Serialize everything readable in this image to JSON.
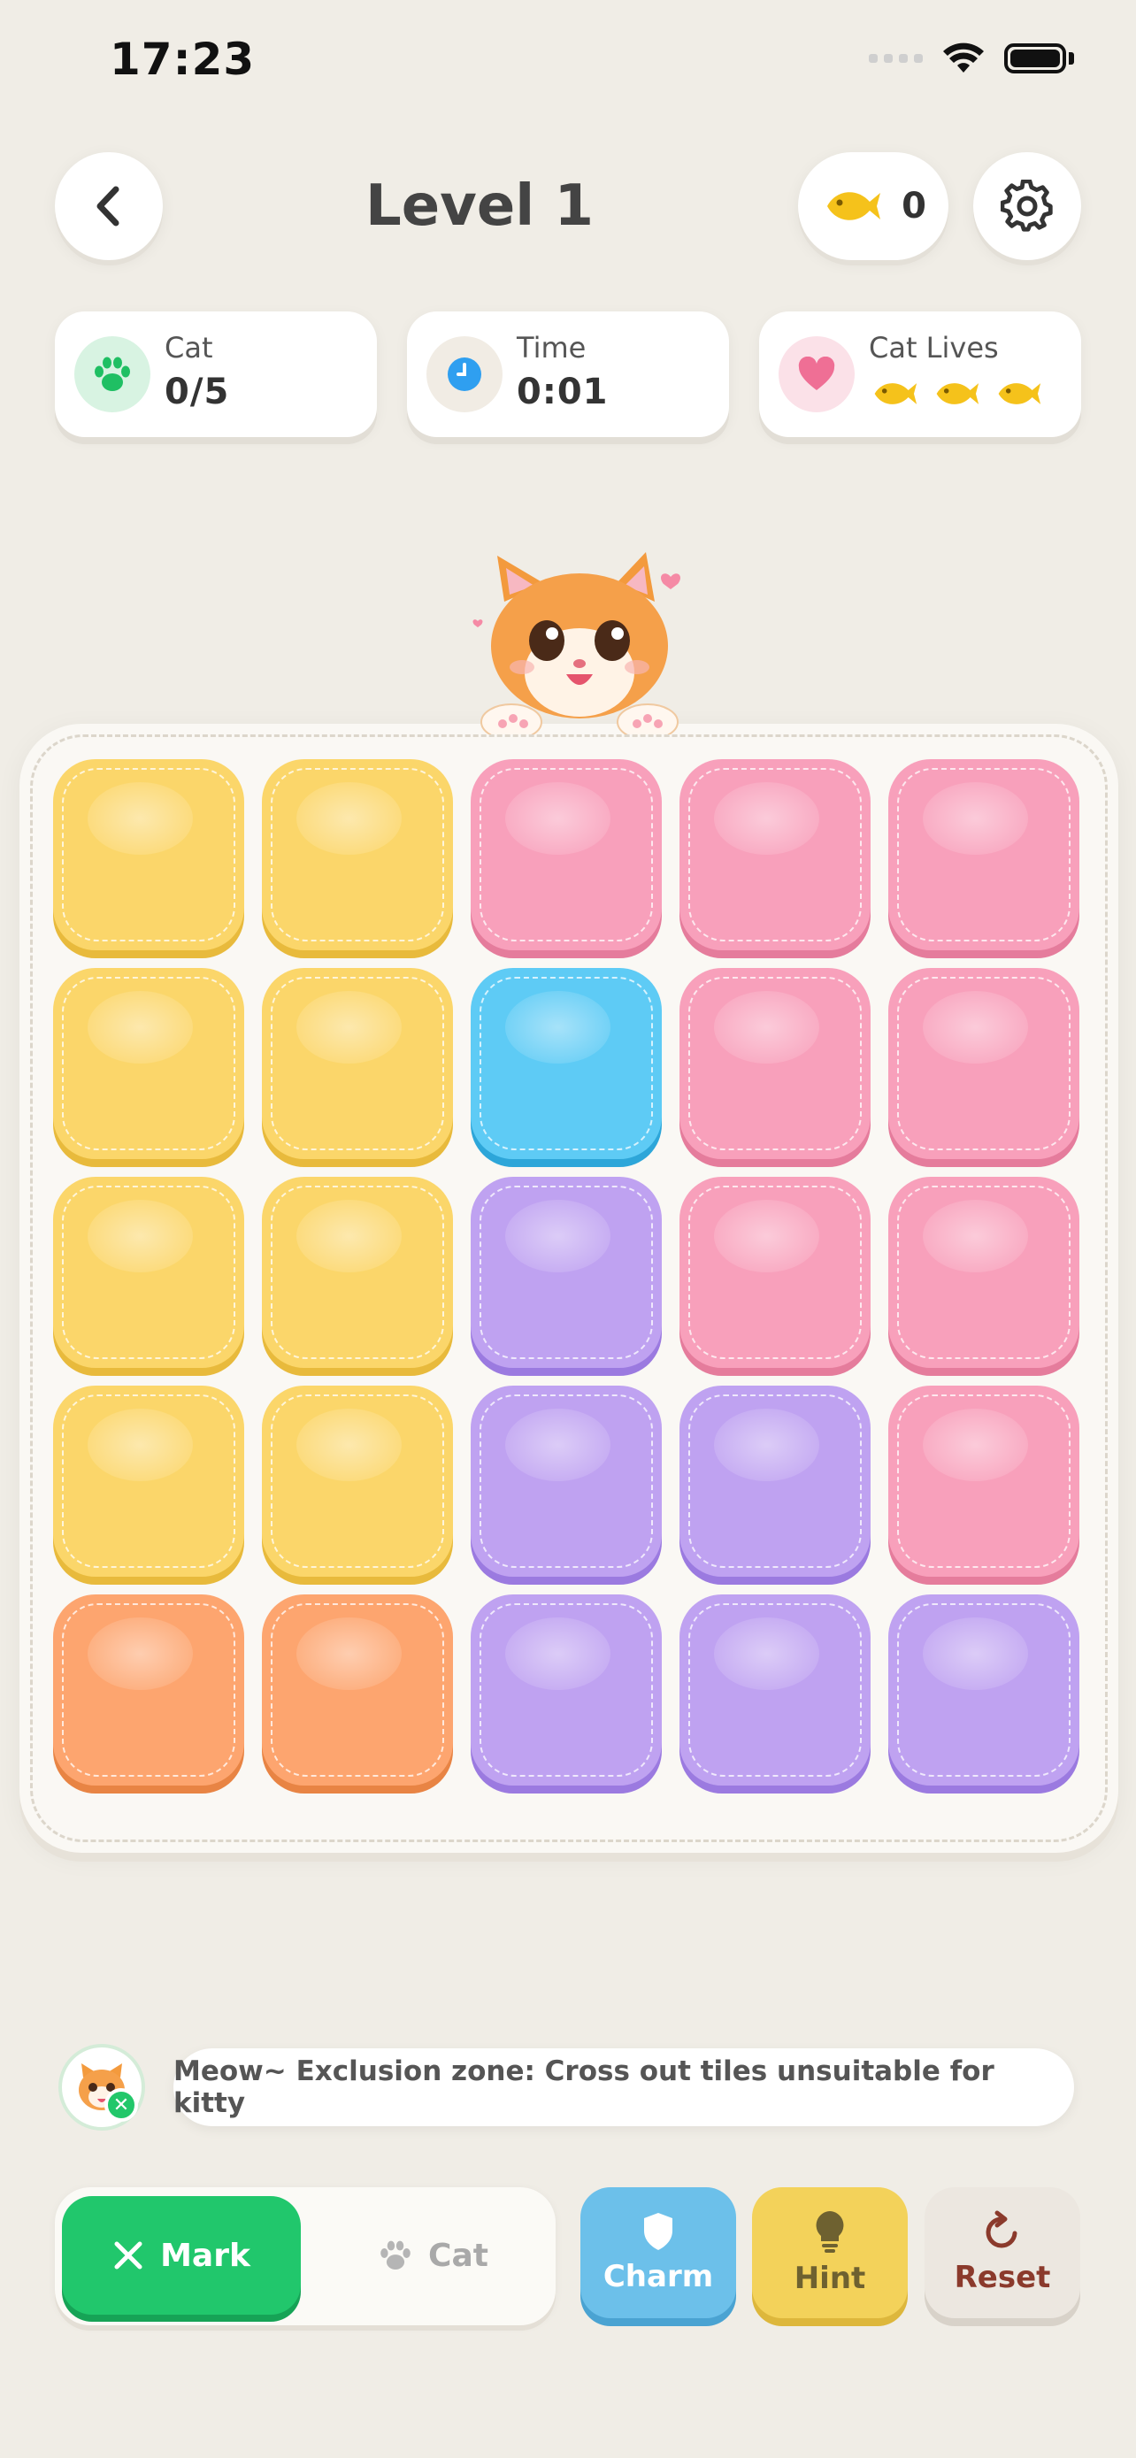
{
  "status_bar": {
    "time": "17:23"
  },
  "header": {
    "title": "Level 1",
    "coins": "0"
  },
  "stats": {
    "cat": {
      "label": "Cat",
      "value": "0/5"
    },
    "time": {
      "label": "Time",
      "value": "0:01"
    },
    "lives": {
      "label": "Cat Lives",
      "count": 3
    }
  },
  "board": {
    "rows": [
      [
        "yellow",
        "yellow",
        "pink",
        "pink",
        "pink"
      ],
      [
        "yellow",
        "yellow",
        "blue",
        "pink",
        "pink"
      ],
      [
        "yellow",
        "yellow",
        "purple",
        "pink",
        "pink"
      ],
      [
        "yellow",
        "yellow",
        "purple",
        "purple",
        "pink"
      ],
      [
        "orange",
        "orange",
        "purple",
        "purple",
        "purple"
      ]
    ]
  },
  "message": {
    "text": "Meow~ Exclusion zone: Cross out tiles unsuitable for kitty"
  },
  "controls": {
    "mark_label": "Mark",
    "cat_label": "Cat",
    "charm_label": "Charm",
    "hint_label": "Hint",
    "reset_label": "Reset"
  },
  "colors": {
    "yellow": "#fbd66a",
    "pink": "#f8a0bb",
    "blue": "#5ecbf5",
    "purple": "#bfa2f1",
    "orange": "#fda56f",
    "accent_green": "#21c76c"
  }
}
